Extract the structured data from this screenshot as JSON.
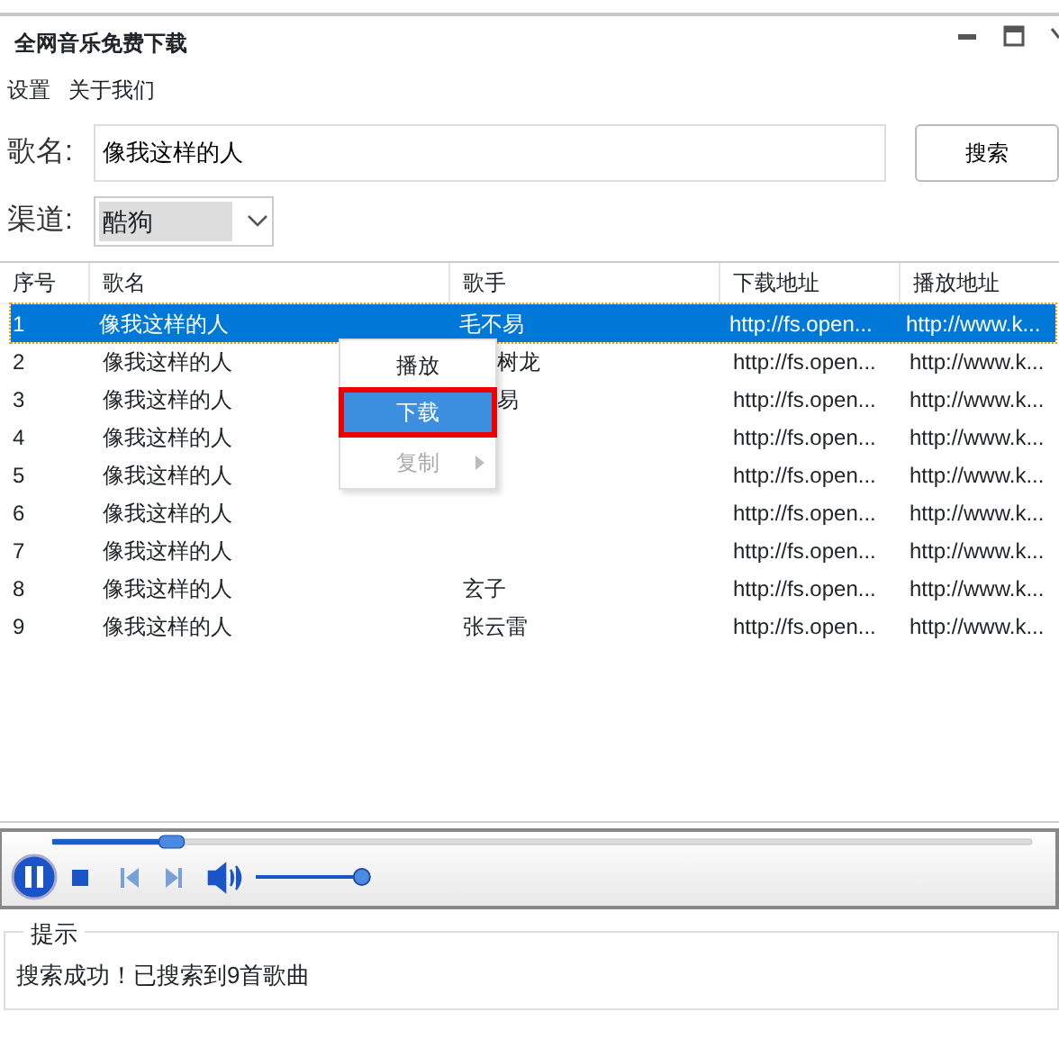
{
  "window": {
    "title": "全网音乐免费下载"
  },
  "menu": [
    "设置",
    "关于我们"
  ],
  "search": {
    "label": "歌名:",
    "value": "像我这样的人",
    "button": "搜索"
  },
  "channel": {
    "label": "渠道:",
    "value": "酷狗"
  },
  "table": {
    "columns": [
      "序号",
      "歌名",
      "歌手",
      "下载地址",
      "播放地址"
    ],
    "rows": [
      {
        "cells": [
          "1",
          "像我这样的人",
          "毛不易",
          "http://fs.open...",
          "http://www.k..."
        ],
        "selected": true
      },
      {
        "cells": [
          "2",
          "像我这样的人",
          "树龙",
          "http://fs.open...",
          "http://www.k..."
        ],
        "selected": false
      },
      {
        "cells": [
          "3",
          "像我这样的人",
          "易",
          "http://fs.open...",
          "http://www.k..."
        ],
        "selected": false
      },
      {
        "cells": [
          "4",
          "像我这样的人",
          "",
          "http://fs.open...",
          "http://www.k..."
        ],
        "selected": false
      },
      {
        "cells": [
          "5",
          "像我这样的人",
          "",
          "http://fs.open...",
          "http://www.k..."
        ],
        "selected": false
      },
      {
        "cells": [
          "6",
          "像我这样的人",
          "",
          "http://fs.open...",
          "http://www.k..."
        ],
        "selected": false
      },
      {
        "cells": [
          "7",
          "像我这样的人",
          "",
          "http://fs.open...",
          "http://www.k..."
        ],
        "selected": false
      },
      {
        "cells": [
          "8",
          "像我这样的人",
          "玄子",
          "http://fs.open...",
          "http://www.k..."
        ],
        "selected": false
      },
      {
        "cells": [
          "9",
          "像我这样的人",
          "张云雷",
          "http://fs.open...",
          "http://www.k..."
        ],
        "selected": false
      }
    ]
  },
  "context_menu": [
    {
      "label": "播放",
      "selected": false,
      "disabled": false
    },
    {
      "label": "下载",
      "selected": true,
      "disabled": false
    },
    {
      "label": "复制",
      "selected": false,
      "disabled": true
    }
  ],
  "player": {
    "seek": {
      "level": 0.12
    },
    "volume": {
      "level": 0.95
    },
    "playing": true
  },
  "hint": {
    "title": "提示",
    "message": "搜索成功！已搜索到9首歌曲"
  }
}
